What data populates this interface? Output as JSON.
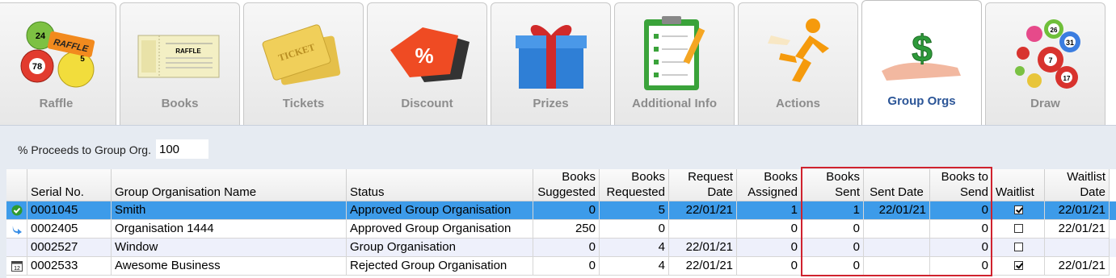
{
  "tabs": [
    {
      "label": "Raffle",
      "icon": "raffle-balls-icon"
    },
    {
      "label": "Books",
      "icon": "books-icon"
    },
    {
      "label": "Tickets",
      "icon": "tickets-icon"
    },
    {
      "label": "Discount",
      "icon": "discount-tag-icon"
    },
    {
      "label": "Prizes",
      "icon": "gift-box-icon"
    },
    {
      "label": "Additional Info",
      "icon": "clipboard-icon"
    },
    {
      "label": "Actions",
      "icon": "running-man-icon"
    },
    {
      "label": "Group Orgs",
      "icon": "money-hand-icon",
      "active": true
    },
    {
      "label": "Draw",
      "icon": "lottery-balls-icon"
    }
  ],
  "art_text": {
    "raffle_ball_1": "24",
    "raffle_ball_2": "78",
    "raffle_ball_3": "5",
    "raffle_ticket": "RAFFLE",
    "book_header": "RAFFLE",
    "ticket_text": "TICKET",
    "discount_text": "%",
    "money_text": "$",
    "draw_ball_1": "26",
    "draw_ball_2": "31",
    "draw_ball_3": "17",
    "draw_ball_4": "7"
  },
  "proceeds": {
    "label": "% Proceeds to Group Org.",
    "value": "100"
  },
  "columns": {
    "serial": "Serial No.",
    "name": "Group Organisation Name",
    "status": "Status",
    "suggested_1": "Books",
    "suggested_2": "Suggested",
    "requested_1": "Books",
    "requested_2": "Requested",
    "reqdate_1": "Request",
    "reqdate_2": "Date",
    "assigned_1": "Books",
    "assigned_2": "Assigned",
    "sent_1": "Books",
    "sent_2": "Sent",
    "sentdate": "Sent Date",
    "tosend_1": "Books to",
    "tosend_2": "Send",
    "waitlist": "Waitlist",
    "waitdate_1": "Waitlist",
    "waitdate_2": "Date"
  },
  "rows": [
    {
      "icon": "green-check-icon",
      "serial": "0001045",
      "name": "Smith",
      "status": "Approved Group Organisation",
      "suggested": "0",
      "requested": "5",
      "reqdate": "22/01/21",
      "assigned": "1",
      "sent": "1",
      "sentdate": "22/01/21",
      "tosend": "0",
      "waitlist": true,
      "waitdate": "22/01/21"
    },
    {
      "icon": "arrow-right-icon",
      "serial": "0002405",
      "name": "Organisation 1444",
      "status": "Approved Group Organisation",
      "suggested": "250",
      "requested": "0",
      "reqdate": "",
      "assigned": "0",
      "sent": "0",
      "sentdate": "",
      "tosend": "0",
      "waitlist": false,
      "waitdate": "22/01/21"
    },
    {
      "icon": "",
      "serial": "0002527",
      "name": "Window",
      "status": "Group Organisation",
      "suggested": "0",
      "requested": "4",
      "reqdate": "22/01/21",
      "assigned": "0",
      "sent": "0",
      "sentdate": "",
      "tosend": "0",
      "waitlist": false,
      "waitdate": ""
    },
    {
      "icon": "calendar-icon",
      "serial": "0002533",
      "name": "Awesome Business",
      "status": "Rejected Group Organisation",
      "suggested": "0",
      "requested": "4",
      "reqdate": "22/01/21",
      "assigned": "0",
      "sent": "0",
      "sentdate": "",
      "tosend": "0",
      "waitlist": true,
      "waitdate": "22/01/21"
    }
  ],
  "calendar_icon_text": "12",
  "colors": {
    "selected_row": "#3d9be9",
    "highlight_box": "#d0222e",
    "active_tab_label": "#2b5597"
  }
}
